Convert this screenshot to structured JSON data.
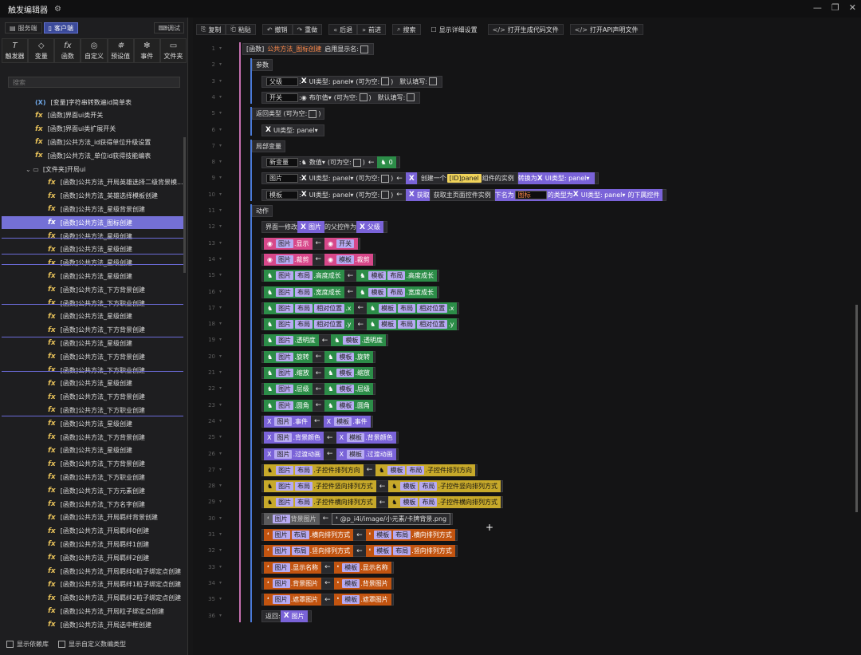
{
  "title": "触发编辑器",
  "title_icon": "gear-icon",
  "left": {
    "tabs": [
      {
        "label": "服务端",
        "icon": "server-icon"
      },
      {
        "label": "客户端",
        "icon": "client-icon"
      }
    ],
    "debug": "调试",
    "tools": [
      {
        "label": "触发器",
        "icon": "T"
      },
      {
        "label": "变量",
        "icon": "◇"
      },
      {
        "label": "函数",
        "icon": "fx"
      },
      {
        "label": "自定义",
        "icon": "◎"
      },
      {
        "label": "预设值",
        "icon": "⛯"
      },
      {
        "label": "事件",
        "icon": "✻"
      },
      {
        "label": "文件夹",
        "icon": "▭"
      }
    ],
    "search_placeholder": "搜索",
    "tree": [
      {
        "t": "[变量]字符串转数遍id简单表",
        "k": "var",
        "x": 44
      },
      {
        "t": "[函数]界面ui类开关",
        "k": "fx",
        "x": 44
      },
      {
        "t": "[函数]界面ui类扩展开关",
        "k": "fx",
        "x": 44
      },
      {
        "t": "[函数]公共方法_id获得单位升级设置",
        "k": "fx",
        "x": 44
      },
      {
        "t": "[函数]公共方法_单位id获得技能编表",
        "k": "fx",
        "x": 44
      },
      {
        "t": "[文件夹]开局ui",
        "k": "folder",
        "x": 32
      },
      {
        "t": "[函数]公共方法_开局英雄选择二级背景模...",
        "k": "fx",
        "x": 60
      },
      {
        "t": "[函数]公共方法_英雄选择模板创建",
        "k": "fx",
        "x": 60
      },
      {
        "t": "[函数]公共方法_星级背景创建",
        "k": "fx",
        "x": 60
      },
      {
        "t": "[函数]公共方法_图标创建",
        "k": "fx",
        "x": 60,
        "sel": true
      },
      {
        "t": "[函数]公共方法_星级创建",
        "k": "fx",
        "x": 60
      },
      {
        "t": "[函数]公共方法_星级创建",
        "k": "fx",
        "x": 60
      },
      {
        "t": "[函数]公共方法_星级创建",
        "k": "fx",
        "x": 60
      },
      {
        "t": "[函数]公共方法_星级创建",
        "k": "fx",
        "x": 60
      },
      {
        "t": "[函数]公共方法_下方背景创建",
        "k": "fx",
        "x": 60
      },
      {
        "t": "[函数]公共方法_下方职业创建",
        "k": "fx",
        "x": 60
      },
      {
        "t": "[函数]公共方法_星级创建",
        "k": "fx",
        "x": 60
      },
      {
        "t": "[函数]公共方法_下方背景创建",
        "k": "fx",
        "x": 60
      },
      {
        "t": "[函数]公共方法_星级创建",
        "k": "fx",
        "x": 60
      },
      {
        "t": "[函数]公共方法_下方背景创建",
        "k": "fx",
        "x": 60
      },
      {
        "t": "[函数]公共方法_下方职业创建",
        "k": "fx",
        "x": 60
      },
      {
        "t": "[函数]公共方法_星级创建",
        "k": "fx",
        "x": 60
      },
      {
        "t": "[函数]公共方法_下方背景创建",
        "k": "fx",
        "x": 60
      },
      {
        "t": "[函数]公共方法_下方职业创建",
        "k": "fx",
        "x": 60
      },
      {
        "t": "[函数]公共方法_星级创建",
        "k": "fx",
        "x": 60
      },
      {
        "t": "[函数]公共方法_下方背景创建",
        "k": "fx",
        "x": 60
      },
      {
        "t": "[函数]公共方法_星级创建",
        "k": "fx",
        "x": 60
      },
      {
        "t": "[函数]公共方法_下方背景创建",
        "k": "fx",
        "x": 60
      },
      {
        "t": "[函数]公共方法_下方职业创建",
        "k": "fx",
        "x": 60
      },
      {
        "t": "[函数]公共方法_下方元素创建",
        "k": "fx",
        "x": 60
      },
      {
        "t": "[函数]公共方法_下方名字创建",
        "k": "fx",
        "x": 60
      },
      {
        "t": "[函数]公共方法_开局羁绊背景创建",
        "k": "fx",
        "x": 60
      },
      {
        "t": "[函数]公共方法_开局羁绊0创建",
        "k": "fx",
        "x": 60
      },
      {
        "t": "[函数]公共方法_开局羁绊1创建",
        "k": "fx",
        "x": 60
      },
      {
        "t": "[函数]公共方法_开局羁绊2创建",
        "k": "fx",
        "x": 60
      },
      {
        "t": "[函数]公共方法_开局羁绊0粒子绑定点创建",
        "k": "fx",
        "x": 60
      },
      {
        "t": "[函数]公共方法_开局羁绊1粒子绑定点创建",
        "k": "fx",
        "x": 60
      },
      {
        "t": "[函数]公共方法_开局羁绊2粒子绑定点创建",
        "k": "fx",
        "x": 60
      },
      {
        "t": "[函数]公共方法_开局粒子绑定点创建",
        "k": "fx",
        "x": 60
      },
      {
        "t": "[函数]公共方法_开局选中框创建",
        "k": "fx",
        "x": 60
      },
      {
        "t": "[函数]公共方法_开局动画用遮罩图片创建",
        "k": "fx",
        "x": 60
      }
    ],
    "bottom": [
      "显示依赖库",
      "显示自定义数编类型"
    ]
  },
  "editor": {
    "toolbar": [
      {
        "l": "复制",
        "i": "⎘"
      },
      {
        "l": "粘贴",
        "i": "⎗"
      },
      {
        "l": "撤销",
        "i": "↶"
      },
      {
        "l": "重做",
        "i": "↷"
      },
      {
        "l": "后退",
        "i": "«"
      },
      {
        "l": "前进",
        "i": "»"
      },
      {
        "l": "搜索",
        "i": "⌕"
      },
      {
        "l": "显示详细设置",
        "i": "☐"
      },
      {
        "l": "打开生成代码文件",
        "i": "</>"
      },
      {
        "l": "打开API声明文件",
        "i": "</>"
      }
    ],
    "lines": [
      "1",
      "2",
      "3",
      "4",
      "5",
      "6",
      "7",
      "8",
      "9",
      "10",
      "11",
      "12",
      "13",
      "14",
      "15",
      "16",
      "17",
      "18",
      "19",
      "20",
      "21",
      "22",
      "23",
      "24",
      "25",
      "26",
      "27",
      "28",
      "29",
      "30",
      "31",
      "32",
      "33",
      "34",
      "35",
      "36"
    ],
    "l1": {
      "a": "[函数]",
      "b": "公共方法_图标创建",
      "c": "启用显示名:"
    },
    "params": "参数",
    "p1": {
      "name": "父级",
      "type": "UI类型: panel",
      "opt": "(可为空:",
      "def": "默认填写:"
    },
    "p2": {
      "name": "开关",
      "type": "布尔值",
      "opt": "(可为空:",
      "def": "默认填写:"
    },
    "ret": "返回类型 (可为空:",
    "rettype": "UI类型: panel",
    "locals": "局部变量",
    "v1": {
      "name": "新变量",
      "type": "数值",
      "opt": "(可为空:",
      "val": "0"
    },
    "v2": {
      "name": "图片",
      "type": "UI类型: panel",
      "opt": "(可为空:",
      "create": "创建一个",
      "id": "[ID]panel",
      "tail": "组件的实例",
      "conv": "转换为",
      "to": "UI类型: panel"
    },
    "v3": {
      "name": "模板",
      "type": "UI类型: panel",
      "opt": "(可为空:",
      "get": "获取",
      "inner": "获取主页面控件实例",
      "mid": "下名为",
      "icon": "图标",
      "tail": "的类型为",
      "to": "UI类型: panel",
      "end": "的下属控件"
    },
    "actions": "动作",
    "a12": {
      "a": "界面一修改",
      "b": "图片",
      "c": "的父控件为",
      "d": "父级"
    },
    "a13": {
      "a": "图片",
      "b": ".显示",
      "c": "开关"
    },
    "a14": {
      "a": "图片",
      "b": ".裁剪",
      "c": "模板",
      "d": ".裁剪"
    },
    "a15": {
      "a": "图片",
      "b": "布局",
      "c": ".高度成长",
      "d": "模板",
      "e": "布局",
      "f": ".高度成长"
    },
    "a16": {
      "a": "图片",
      "b": "布局",
      "c": ".宽度成长",
      "d": "模板",
      "e": "布局",
      "f": ".宽度成长"
    },
    "a17": {
      "a": "图片",
      "b": "布局",
      "c": "相对位置",
      "d": ".x",
      "e": "模板",
      "f": "布局",
      "g": "相对位置",
      "h": ".x"
    },
    "a18": {
      "a": "图片",
      "b": "布局",
      "c": "相对位置",
      "d": ".y",
      "e": "模板",
      "f": "布局",
      "g": "相对位置",
      "h": ".y"
    },
    "a19": {
      "a": "图片",
      "b": ".透明度",
      "c": "模板",
      "d": ".透明度"
    },
    "a20": {
      "a": "图片",
      "b": ".旋转",
      "c": "模板",
      "d": ".旋转"
    },
    "a21": {
      "a": "图片",
      "b": ".缩放",
      "c": "模板",
      "d": ".缩放"
    },
    "a22": {
      "a": "图片",
      "b": ".层级",
      "c": "模板",
      "d": ".层级"
    },
    "a23": {
      "a": "图片",
      "b": ".圆角",
      "c": "模板",
      "d": ".圆角"
    },
    "a24": {
      "a": "图片",
      "b": ".事件",
      "c": "模板",
      "d": ".事件"
    },
    "a25": {
      "a": "图片",
      "b": ".背景颜色",
      "c": "模板",
      "d": ".背景颜色"
    },
    "a26": {
      "a": "图片",
      "b": ".过渡动画",
      "c": "模板",
      "d": ".过渡动画"
    },
    "a27": {
      "a": "图片",
      "b": "布局",
      "c": ".子控件排列方向",
      "d": "模板",
      "e": "布局",
      "f": ".子控件排列方向"
    },
    "a28": {
      "a": "图片",
      "b": "布局",
      "c": ".子控件竖向排列方式",
      "d": "模板",
      "e": "布局",
      "f": ".子控件竖向排列方式"
    },
    "a29": {
      "a": "图片",
      "b": "布局",
      "c": ".子控件横向排列方式",
      "d": "模板",
      "e": "布局",
      "f": ".子控件横向排列方式"
    },
    "a30": {
      "a": "图片",
      "b": "背景图片",
      "c": "@p_i4i/image/小元素/卡牌背景.png"
    },
    "a31": {
      "a": "图片",
      "b": "布局",
      "c": ".横向排列方式",
      "d": "模板",
      "e": "布局",
      "f": ".横向排列方式"
    },
    "a32": {
      "a": "图片",
      "b": "布局",
      "c": ".竖向排列方式",
      "d": "模板",
      "e": "布局",
      "f": ".竖向排列方式"
    },
    "a33": {
      "a": "图片",
      "b": ".显示名称",
      "c": "模板",
      "d": ".显示名称"
    },
    "a34": {
      "a": "图片",
      "b": ".背景图片",
      "c": "模板",
      "d": ".背景图片"
    },
    "a35": {
      "a": "图片",
      "b": ".遮罩图片",
      "c": "模板",
      "d": ".遮罩图片"
    },
    "a36": {
      "a": "返回:",
      "b": "图片"
    },
    "arrow": "←",
    "colon": ":",
    "close": ")",
    "plus": "+"
  }
}
